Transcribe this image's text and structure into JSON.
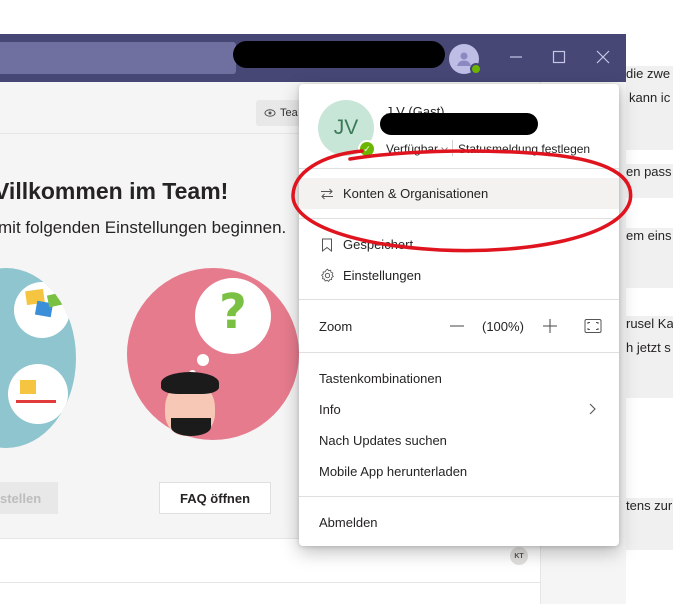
{
  "window": {
    "team_chip_label": "Tea",
    "welcome_title": "Villkommen im Team!",
    "welcome_subtitle": "mit folgenden Einstellungen beginnen.",
    "left_button_label": "stellen",
    "faq_button_label": "FAQ öffnen",
    "feed_badge": "KT"
  },
  "background_chat": [
    {
      "text": "die zwe"
    },
    {
      "text": "kann ic"
    },
    {
      "text": "en pass"
    },
    {
      "text": "em eins"
    },
    {
      "text": "rusel Ka"
    },
    {
      "text": "h jetzt s"
    },
    {
      "text": "tens zur"
    }
  ],
  "menu": {
    "profile": {
      "initials": "JV",
      "name": "J V (Gast)",
      "availability": "Verfügbar",
      "status_message": "Statusmeldung festlegen"
    },
    "accounts_label": "Konten & Organisationen",
    "saved_label": "Gespeichert",
    "settings_label": "Einstellungen",
    "zoom": {
      "label": "Zoom",
      "value": "(100%)"
    },
    "shortcuts_label": "Tastenkombinationen",
    "info_label": "Info",
    "updates_label": "Nach Updates suchen",
    "mobile_label": "Mobile App herunterladen",
    "signout_label": "Abmelden"
  },
  "colors": {
    "titlebar": "#464775",
    "status_available": "#6bb700",
    "annotation_red": "#e0141e",
    "illustration_pink": "#e67b8d",
    "illustration_teal": "#8ec5cf"
  },
  "icons": {
    "accounts": "arrows-swap-icon",
    "saved": "bookmark-icon",
    "settings": "gear-icon",
    "info": "chevron-right-icon",
    "zoom_minus": "minus-icon",
    "zoom_plus": "plus-icon",
    "zoom_fit": "fullscreen-icon"
  }
}
